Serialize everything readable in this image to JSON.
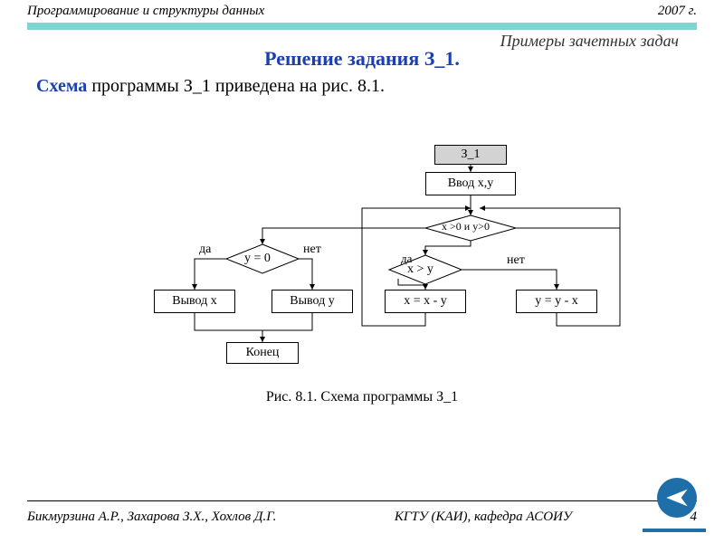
{
  "header": {
    "left": "Программирование  и структуры данных",
    "right": "2007 г."
  },
  "subtitle": "Примеры зачетных задач",
  "title": "Решение задания З_1.",
  "paragraph": {
    "keyword": "Схема",
    "rest": " программы З_1 приведена на рис. 8.1."
  },
  "flow": {
    "start": "З_1",
    "input": "Ввод x,y",
    "cond_main": "x >0 и y>0",
    "cond_left": "y = 0",
    "cond_right": "x > y",
    "yes": "да",
    "no": "нет",
    "out_x": "Вывод  x",
    "out_y": "Вывод  y",
    "x_eq": "x = x - y",
    "y_eq": "y = y - x",
    "end": "Конец"
  },
  "caption": "Рис. 8.1.  Схема программы З_1",
  "footer": {
    "authors": "Бикмурзина А.Р., Захарова З.Х., Хохлов Д.Г.",
    "org": "КГТУ  (КАИ),  кафедра АСОИУ",
    "page": "4"
  }
}
